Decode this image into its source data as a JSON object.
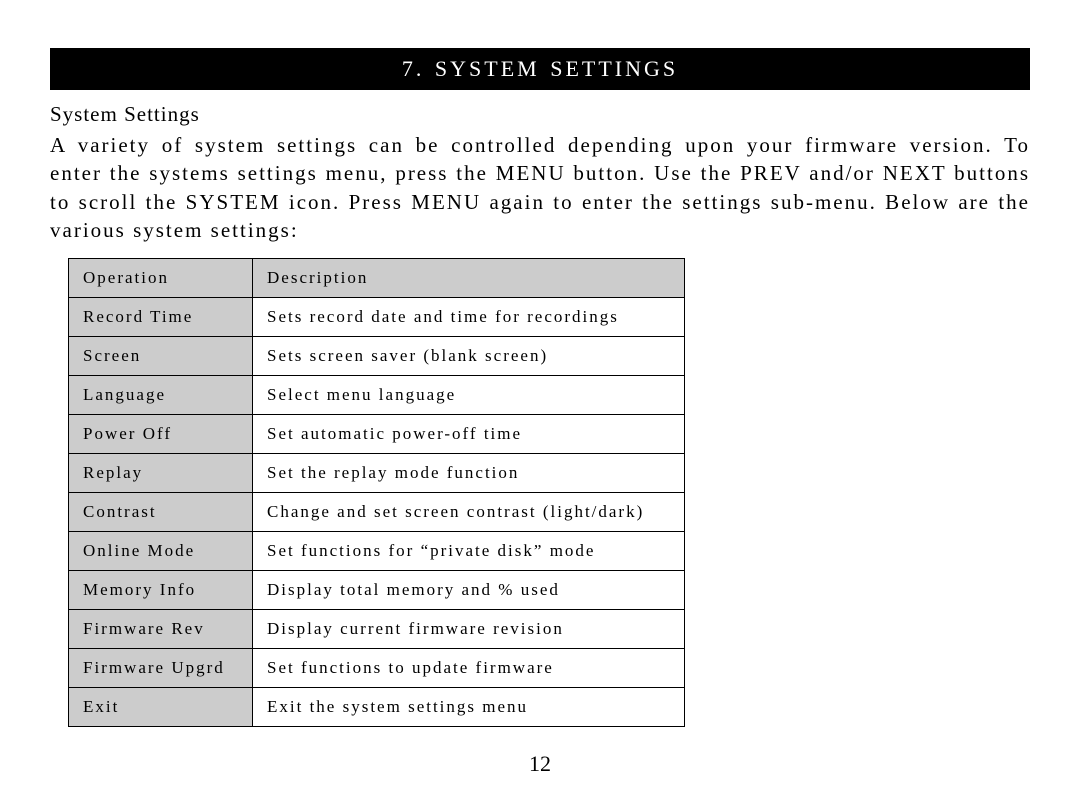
{
  "header": {
    "title": "7.  SYSTEM SETTINGS"
  },
  "section": {
    "subtitle": "System Settings",
    "intro": "A variety of system settings can be controlled depending upon your firmware version.  To enter the systems settings menu, press the MENU button.  Use the PREV and/or NEXT buttons to scroll the SYSTEM icon.  Press MENU again to enter the settings sub-menu.  Below are the various system settings:"
  },
  "table": {
    "columns": [
      "Operation",
      "Description"
    ],
    "rows": [
      {
        "operation": "Record Time",
        "description": "Sets record date and time for recordings"
      },
      {
        "operation": "Screen",
        "description": "Sets screen saver (blank screen)"
      },
      {
        "operation": "Language",
        "description": "Select menu language"
      },
      {
        "operation": "Power Off",
        "description": "Set automatic power-off time"
      },
      {
        "operation": "Replay",
        "description": "Set the replay mode function"
      },
      {
        "operation": "Contrast",
        "description": "Change and set screen contrast (light/dark)"
      },
      {
        "operation": "Online Mode",
        "description": "Set functions for “private disk” mode"
      },
      {
        "operation": "Memory Info",
        "description": "Display total memory and % used"
      },
      {
        "operation": "Firmware Rev",
        "description": "Display current firmware revision"
      },
      {
        "operation": "Firmware Upgrd",
        "description": "Set functions to update firmware"
      },
      {
        "operation": "Exit",
        "description": "Exit the system settings menu"
      }
    ]
  },
  "page_number": "12"
}
